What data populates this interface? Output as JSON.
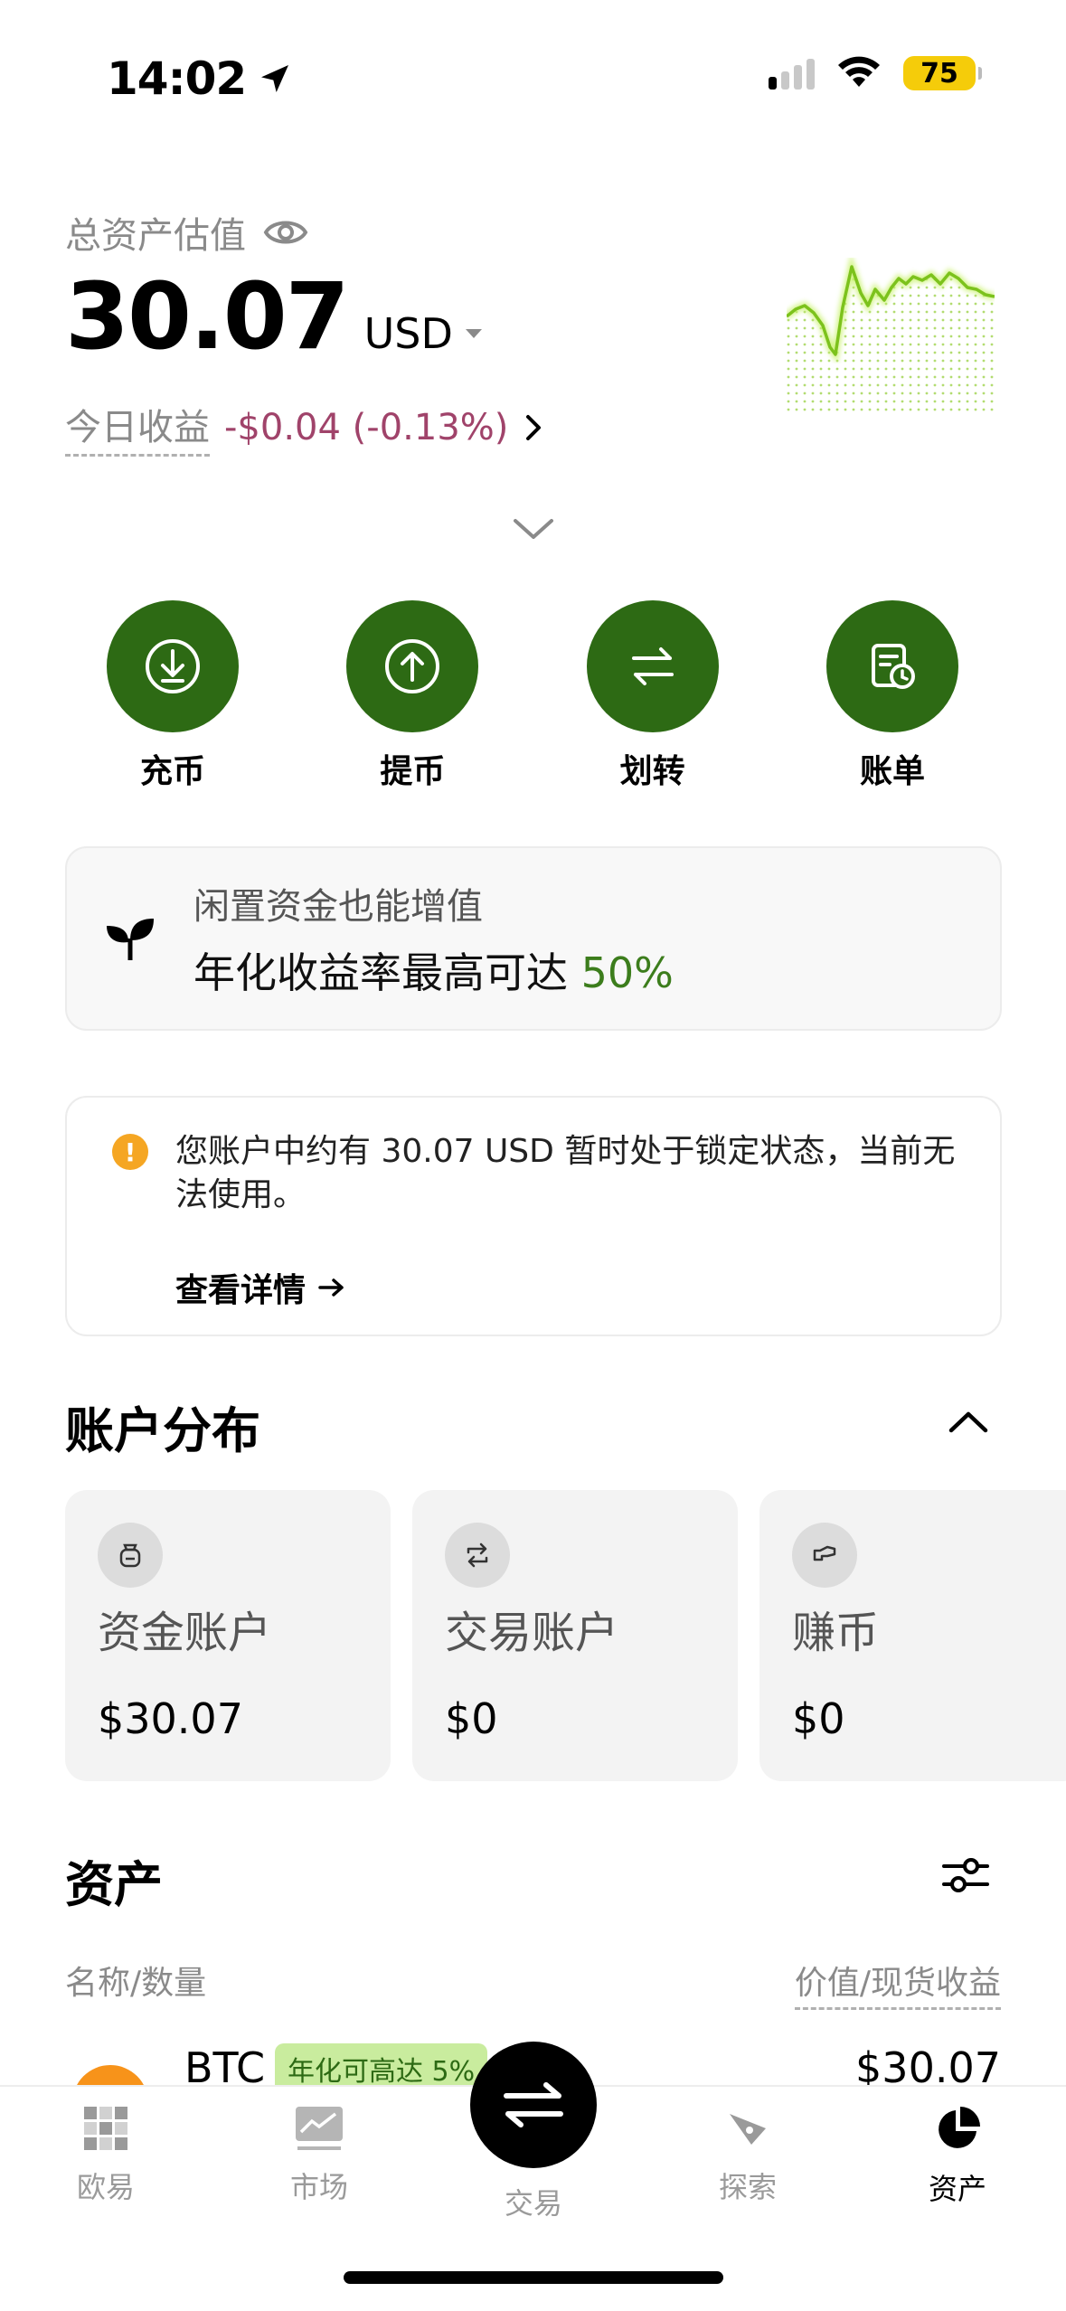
{
  "status_bar": {
    "time": "14:02",
    "battery": "75"
  },
  "header": {
    "total_label": "总资产估值",
    "total_value": "30.07",
    "currency": "USD",
    "pnl_label": "今日收益",
    "pnl_value": "-$0.04 (-0.13%)",
    "sparkline_color": "#8fd32a"
  },
  "actions": [
    {
      "label": "充币",
      "icon": "deposit-icon"
    },
    {
      "label": "提币",
      "icon": "withdraw-icon"
    },
    {
      "label": "划转",
      "icon": "transfer-icon"
    },
    {
      "label": "账单",
      "icon": "bill-icon"
    }
  ],
  "earn_banner": {
    "title": "闲置资金也能增值",
    "subtitle": "年化收益率最高可达 ",
    "percent": "50%"
  },
  "notice": {
    "text": "您账户中约有 30.07 USD 暂时处于锁定状态，当前无法使用。",
    "link": "查看详情"
  },
  "distribution": {
    "title": "账户分布",
    "accounts": [
      {
        "name": "资金账户",
        "value": "$30.07",
        "icon": "funding-account-icon"
      },
      {
        "name": "交易账户",
        "value": "$0",
        "icon": "trading-account-icon"
      },
      {
        "name": "赚币",
        "value": "$0",
        "icon": "earn-icon"
      }
    ]
  },
  "assets": {
    "title": "资产",
    "col_left": "名称/数量",
    "col_right": "价值/现货收益",
    "rows": [
      {
        "symbol": "BTC",
        "tag": "年化可高达 5%",
        "value": "$30.07"
      }
    ]
  },
  "tabs": [
    {
      "label": "欧易",
      "icon": "okx-logo-icon"
    },
    {
      "label": "市场",
      "icon": "market-chart-icon"
    },
    {
      "label": "交易",
      "icon": "trade-swap-icon"
    },
    {
      "label": "探索",
      "icon": "explore-compass-icon"
    },
    {
      "label": "资产",
      "icon": "assets-pie-icon"
    }
  ],
  "colors": {
    "accent_green": "#2d6a14",
    "negative": "#a0436a",
    "highlight_green": "#3c7d1c",
    "warning": "#f5a623"
  }
}
